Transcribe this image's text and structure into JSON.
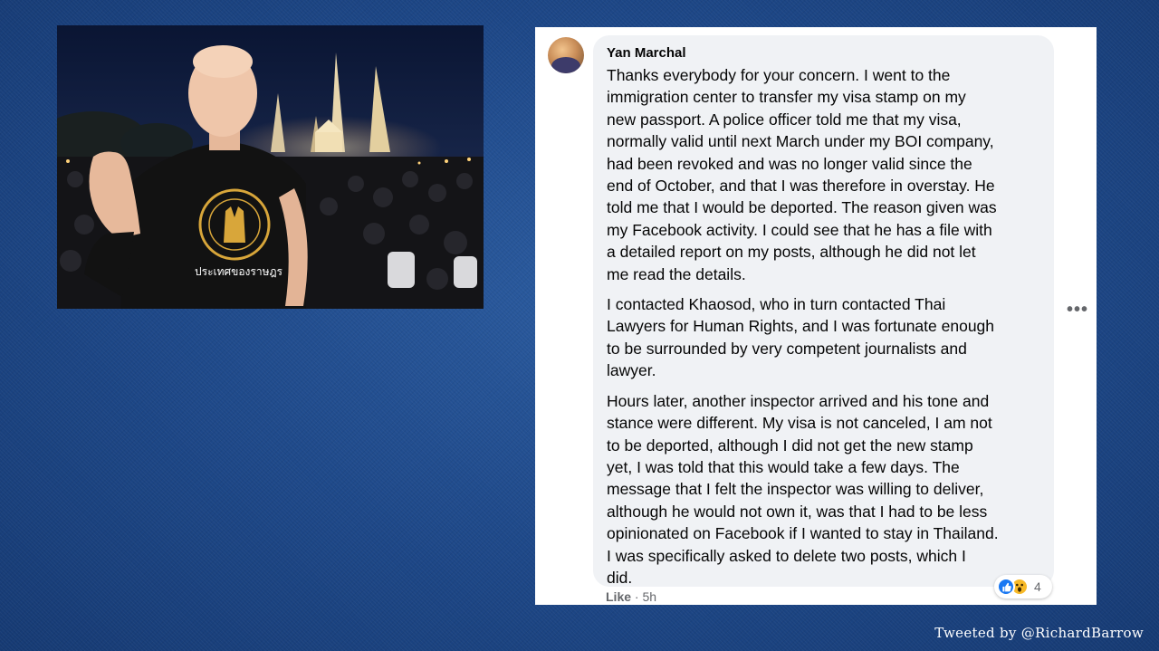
{
  "comment": {
    "author": "Yan Marchal",
    "paragraphs": [
      "Thanks everybody for your concern. I went to the\nimmigration center to transfer my visa stamp on my\nnew passport. A police officer told me that my visa,\nnormally valid until next March under my BOI company,\nhad been revoked and was no longer valid since the\nend of October, and that I was therefore in overstay. He\ntold me that I would be deported. The reason given was\nmy Facebook activity. I could see that he has a file with\na detailed report on my posts, although he did not let\nme read the details.",
      "I contacted Khaosod, who in turn contacted Thai\nLawyers for Human Rights, and I was fortunate enough\nto be surrounded by very competent journalists and\nlawyer.",
      "Hours later, another inspector arrived and his tone and\nstance were different. My visa is not canceled, I am not\nto be deported, although I did not get the new stamp\nyet, I was told that this would take a few days. The\nmessage that I felt the inspector was willing to deliver,\nalthough he would not own it, was that I had to be less\nopinionated on Facebook if I wanted to stay in Thailand.\nI was specifically asked to delete two posts, which I\ndid."
    ],
    "like_label": "Like",
    "separator": " · ",
    "time": "5h",
    "more_label": "•••",
    "reaction_count": "4",
    "reaction_icons": [
      "like-icon",
      "wow-icon"
    ]
  },
  "photo": {
    "shirt_text": "ประเทศของราษฎร"
  },
  "credit": "Tweeted by @RichardBarrow",
  "colors": {
    "background": "#1d4787",
    "bubble": "#f0f2f5",
    "like_blue": "#1877f2",
    "wow_yellow": "#f7b928",
    "shirt_gold": "#d8a63a"
  }
}
